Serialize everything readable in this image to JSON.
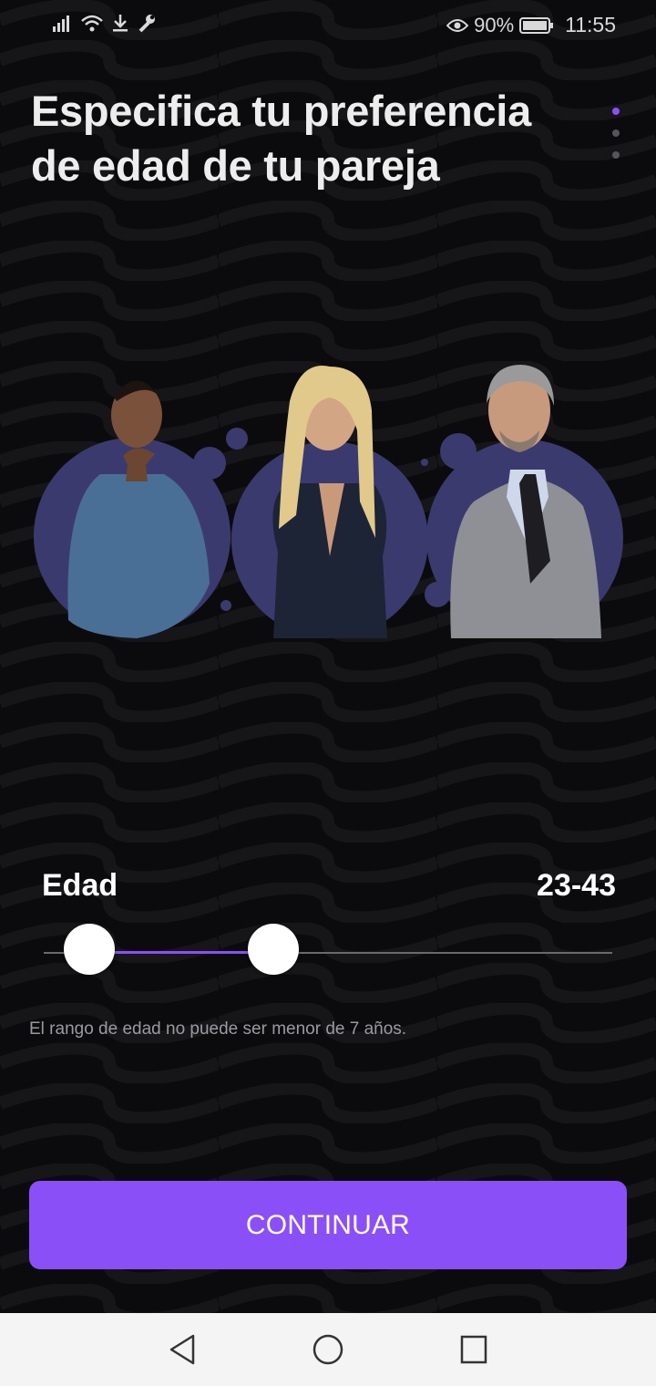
{
  "status_bar": {
    "battery": "90%",
    "time": "11:55"
  },
  "title": "Especifica tu preferencia de edad de tu pareja",
  "pager": {
    "count": 3,
    "active": 0
  },
  "age": {
    "label": "Edad",
    "value": "23-43",
    "range_min": 23,
    "range_max": 43
  },
  "hint": "El rango de edad no puede ser menor de 7 años.",
  "continue_label": "CONTINUAR",
  "colors": {
    "accent": "#8b4ff7",
    "background": "#0b0b0d",
    "avatar_circle": "#3b3a6e"
  },
  "icons": [
    "signal-icon",
    "wifi-icon",
    "download-icon",
    "wrench-icon",
    "eye-icon",
    "battery-icon",
    "back-icon",
    "home-icon",
    "recents-icon"
  ]
}
